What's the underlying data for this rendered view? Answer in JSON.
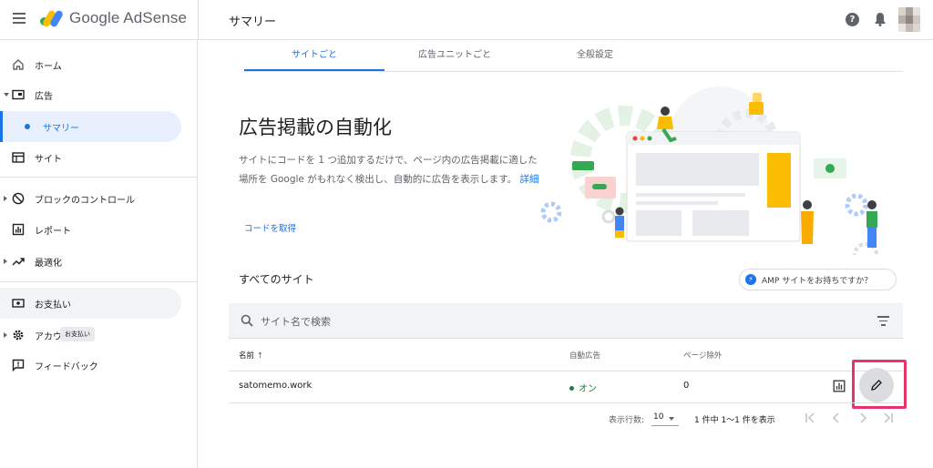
{
  "header": {
    "app_name": "Google AdSense",
    "page_title": "サマリー",
    "help_label": "?"
  },
  "sidebar": {
    "items": [
      {
        "label": "ホーム"
      },
      {
        "label": "広告"
      },
      {
        "label": "サマリー"
      },
      {
        "label": "サイト"
      },
      {
        "label": "ブロックのコントロール"
      },
      {
        "label": "レポート"
      },
      {
        "label": "最適化"
      },
      {
        "label": "お支払い"
      },
      {
        "label": "アカウ"
      },
      {
        "label": "フィードバック"
      }
    ],
    "tooltip": "お支払い"
  },
  "tabs": [
    {
      "label": "サイトごと"
    },
    {
      "label": "広告ユニットごと"
    },
    {
      "label": "全般設定"
    }
  ],
  "hero": {
    "title": "広告掲載の自動化",
    "body": "サイトにコードを 1 つ追加するだけで、ページ内の広告掲載に適した場所を Google がもれなく検出し、自動的に広告を表示します。",
    "details_link": "詳細",
    "get_code_link": "コードを取得"
  },
  "sites": {
    "title": "すべてのサイト",
    "amp_button": "AMP サイトをお持ちですか？",
    "amp_icon_glyph": "⚡",
    "search_placeholder": "サイト名で検索",
    "columns": {
      "name": "名前",
      "name_sort": "↑",
      "auto_ads": "自動広告",
      "page_exclusions": "ページ除外"
    },
    "rows": [
      {
        "name": "satomemo.work",
        "auto_ads": "オン",
        "page_exclusions": "0"
      }
    ]
  },
  "pagination": {
    "rows_per_page_label": "表示行数:",
    "rows_per_page": "10",
    "range": "1 件中 1〜1 件を表示"
  },
  "colors": {
    "accent": "#1a73e8",
    "status_on": "#188038",
    "highlight": "#e8336b"
  }
}
